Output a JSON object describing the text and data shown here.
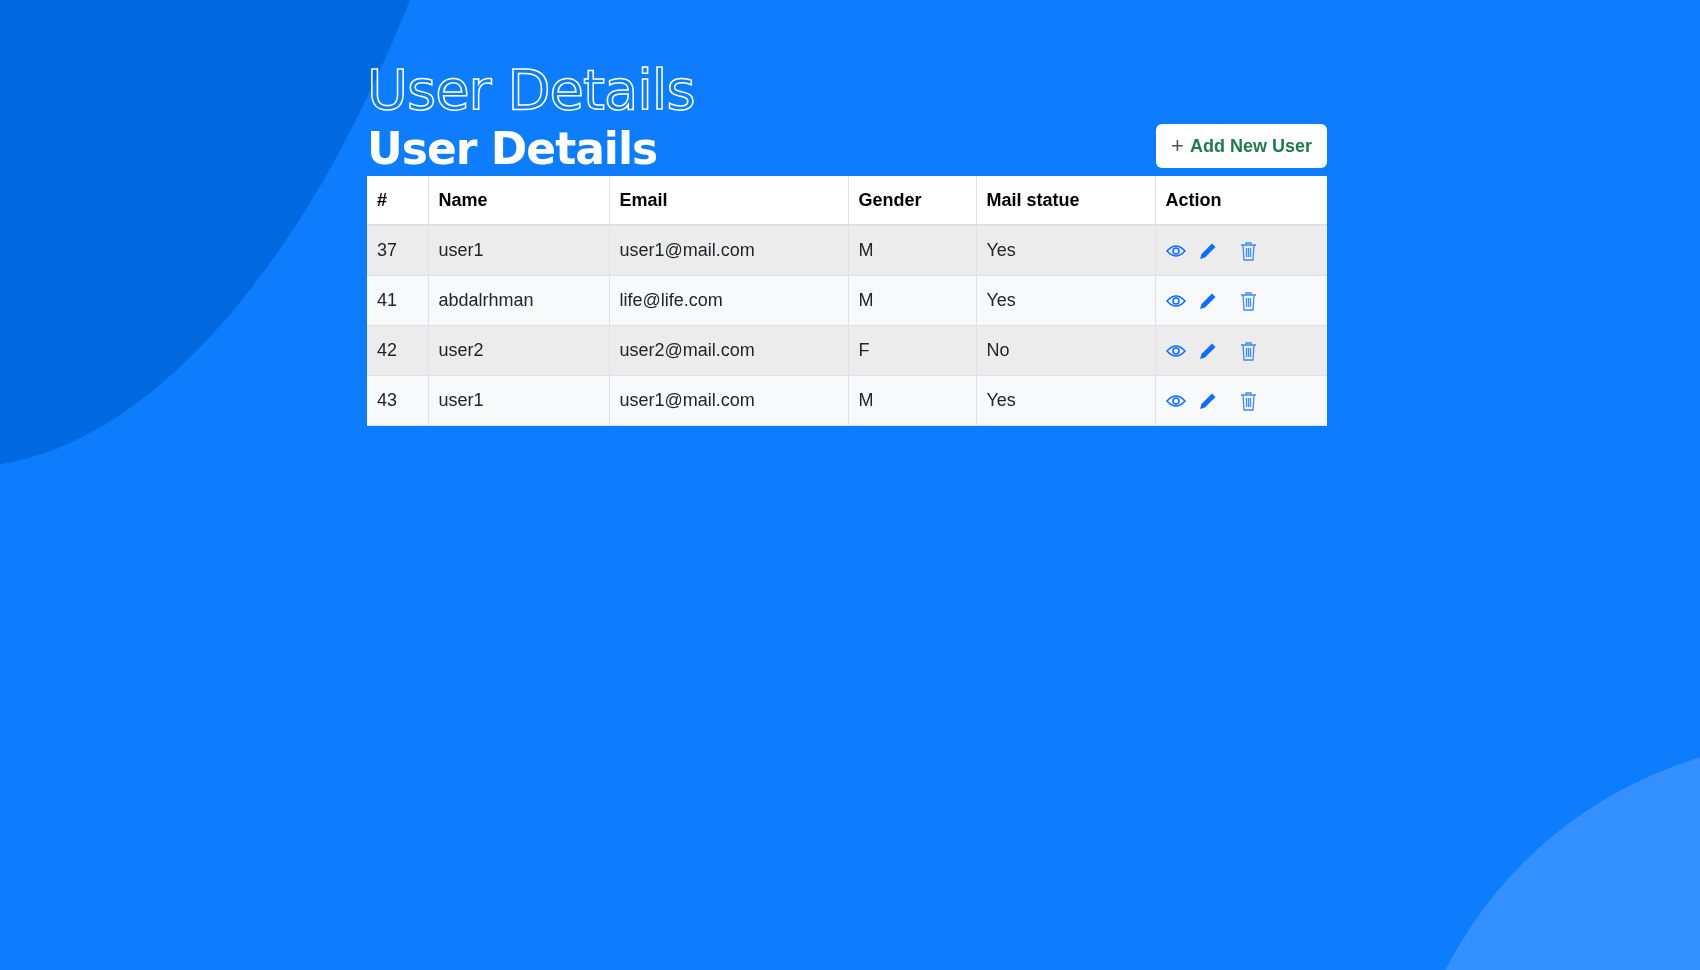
{
  "outline_title": "User Details",
  "title": "User Details",
  "add_button": {
    "icon": "+",
    "label": "Add New User"
  },
  "table": {
    "columns": [
      "#",
      "Name",
      "Email",
      "Gender",
      "Mail statue",
      "Action"
    ],
    "rows": [
      {
        "id": "37",
        "name": "user1",
        "email": "user1@mail.com",
        "gender": "M",
        "mail_status": "Yes"
      },
      {
        "id": "41",
        "name": "abdalrhman",
        "email": "life@life.com",
        "gender": "M",
        "mail_status": "Yes"
      },
      {
        "id": "42",
        "name": "user2",
        "email": "user2@mail.com",
        "gender": "F",
        "mail_status": "No"
      },
      {
        "id": "43",
        "name": "user1",
        "email": "user1@mail.com",
        "gender": "M",
        "mail_status": "Yes"
      }
    ]
  }
}
